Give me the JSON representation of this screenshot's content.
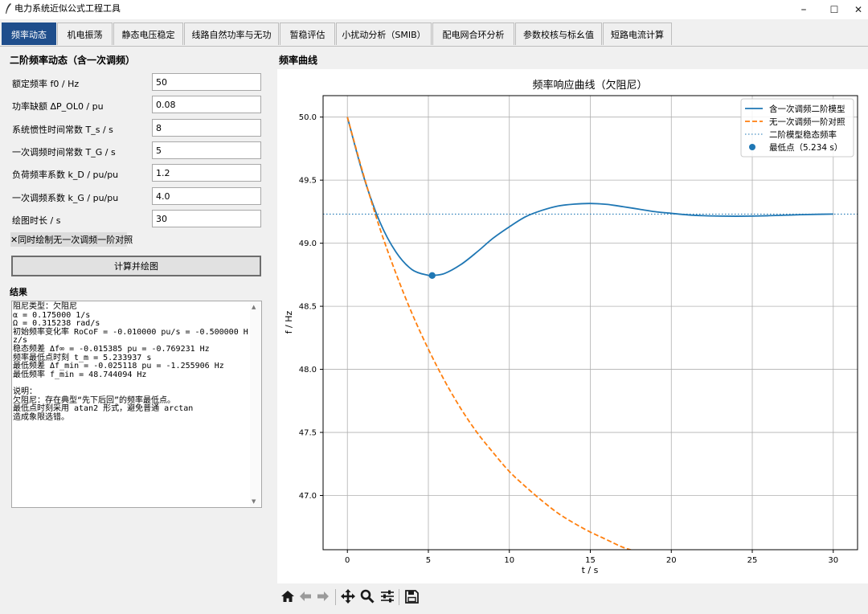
{
  "window": {
    "title": "电力系统近似公式工程工具",
    "minimize": "–",
    "maximize": "☐",
    "close": "✕"
  },
  "tabs": [
    {
      "label": "频率动态",
      "active": true
    },
    {
      "label": "机电振荡"
    },
    {
      "label": "静态电压稳定"
    },
    {
      "label": "线路自然功率与无功"
    },
    {
      "label": "暂稳评估"
    },
    {
      "label": "小扰动分析（SMIB）"
    },
    {
      "label": "配电网合环分析"
    },
    {
      "label": "参数校核与标幺值"
    },
    {
      "label": "短路电流计算"
    }
  ],
  "left": {
    "heading": "二阶频率动态（含一次调频）",
    "fields": [
      {
        "label": "额定频率 f0 / Hz",
        "value": "50"
      },
      {
        "label": "功率缺额 ΔP_OL0 / pu",
        "value": "0.08"
      },
      {
        "label": "系统惯性时间常数 T_s / s",
        "value": "8"
      },
      {
        "label": "一次调频时间常数 T_G / s",
        "value": "5"
      },
      {
        "label": "负荷频率系数 k_D / pu/pu",
        "value": "1.2"
      },
      {
        "label": "一次调频系数 k_G / pu/pu",
        "value": "4.0"
      },
      {
        "label": "绘图时长 / s",
        "value": "30"
      }
    ],
    "checkbox": {
      "mark": "✕",
      "label": "同时绘制无一次调频一阶对照"
    },
    "compute_button": "计算并绘图",
    "result_heading": "结果",
    "result_text": "阻尼类型：欠阻尼\nα = 0.175000 1/s\nΩ = 0.315238 rad/s\n初始频率变化率 RoCoF = -0.010000 pu/s = -0.500000 Hz/s\n稳态频差 Δf∞ = -0.015385 pu = -0.769231 Hz\n频率最低点时刻 t_m = 5.233937 s\n最低频差 Δf_min = -0.025118 pu = -1.255906 Hz\n最低频率 f_min = 48.744094 Hz\n\n说明：\n欠阻尼：存在典型“先下后回”的频率最低点。\n最低点时刻采用 atan2 形式，避免普通 arctan\n造成象限选错。"
  },
  "right": {
    "heading": "频率曲线"
  },
  "chart_data": {
    "type": "line",
    "title": "频率响应曲线（欠阻尼）",
    "xlabel": "t / s",
    "ylabel": "f / Hz",
    "xlim": [
      -1.5,
      31.5
    ],
    "ylim": [
      46.57,
      50.17
    ],
    "xticks": [
      0,
      5,
      10,
      15,
      20,
      25,
      30
    ],
    "yticks": [
      47.0,
      47.5,
      48.0,
      48.5,
      49.0,
      49.5,
      50.0
    ],
    "grid": true,
    "legend_position": "top-right",
    "series": [
      {
        "name": "含一次调频二阶模型",
        "style": "solid",
        "color": "#1f77b4",
        "x": [
          0,
          1,
          2,
          3,
          4,
          5,
          5.234,
          6,
          7,
          8,
          9,
          10,
          11,
          12,
          13,
          14,
          15,
          16,
          17,
          18,
          19,
          20,
          21,
          22,
          23,
          24,
          25,
          26,
          27,
          28,
          29,
          30
        ],
        "y": [
          50.0,
          49.53,
          49.17,
          48.93,
          48.79,
          48.745,
          48.744,
          48.76,
          48.83,
          48.93,
          49.04,
          49.13,
          49.21,
          49.26,
          49.295,
          49.31,
          49.315,
          49.308,
          49.29,
          49.27,
          49.25,
          49.237,
          49.225,
          49.218,
          49.215,
          49.214,
          49.215,
          49.218,
          49.222,
          49.226,
          49.229,
          49.231
        ]
      },
      {
        "name": "无一次调频一阶对照",
        "style": "dashed",
        "color": "#ff7f0e",
        "x": [
          0,
          1,
          2,
          3,
          4,
          5,
          6,
          7,
          8,
          9,
          10,
          11,
          12,
          13,
          14,
          15,
          16,
          17,
          18,
          19,
          20,
          21,
          22,
          23,
          24,
          25,
          26,
          27,
          28,
          29,
          30
        ],
        "y": [
          50.0,
          49.54,
          49.12,
          48.76,
          48.44,
          48.16,
          47.91,
          47.69,
          47.5,
          47.34,
          47.19,
          47.07,
          46.96,
          46.86,
          46.78,
          46.71,
          46.65,
          46.59,
          46.55,
          46.51,
          46.47,
          46.44,
          46.42,
          46.4,
          46.38,
          46.36,
          46.35,
          46.34,
          46.33,
          46.32,
          46.31
        ]
      },
      {
        "name": "二阶模型稳态频率",
        "style": "dotted",
        "color": "#1f77b4",
        "x": [
          -1.5,
          31.5
        ],
        "y": [
          49.2308,
          49.2308
        ]
      },
      {
        "name": "最低点（5.234 s）",
        "style": "marker",
        "color": "#1f77b4",
        "x": [
          5.234
        ],
        "y": [
          48.744
        ]
      }
    ]
  }
}
